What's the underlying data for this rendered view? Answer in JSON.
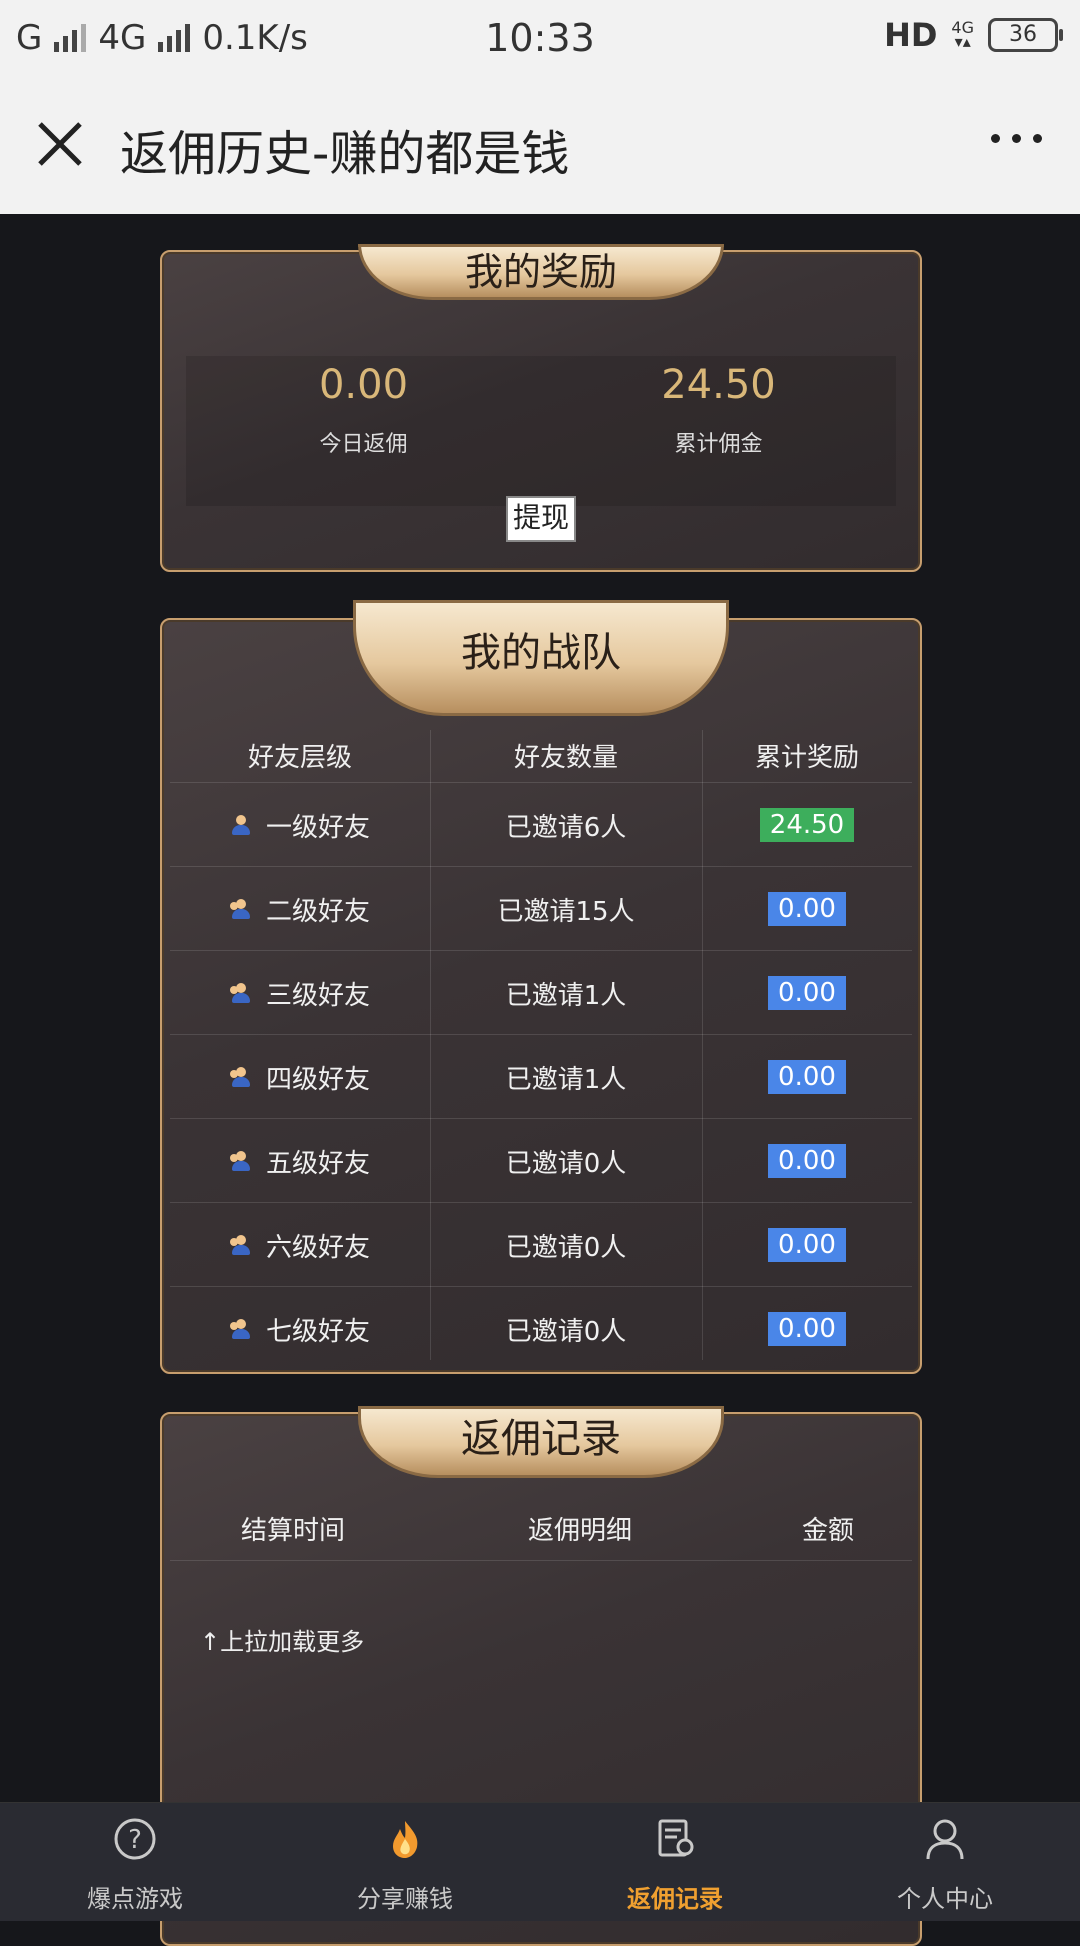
{
  "status_bar": {
    "carrier": "G",
    "network": "4G",
    "speed": "0.1K/s",
    "time": "10:33",
    "hd": "HD",
    "net_badge": "4G",
    "battery": "36"
  },
  "nav": {
    "title": "返佣历史-赚的都是钱"
  },
  "reward": {
    "title": "我的奖励",
    "today_value": "0.00",
    "today_label": "今日返佣",
    "total_value": "24.50",
    "total_label": "累计佣金",
    "withdraw_label": "提现"
  },
  "team": {
    "title": "我的战队",
    "headers": [
      "好友层级",
      "好友数量",
      "累计奖励"
    ],
    "rows": [
      {
        "level": "一级好友",
        "count": "已邀请6人",
        "reward": "24.50",
        "color": "green"
      },
      {
        "level": "二级好友",
        "count": "已邀请15人",
        "reward": "0.00",
        "color": "blue"
      },
      {
        "level": "三级好友",
        "count": "已邀请1人",
        "reward": "0.00",
        "color": "blue"
      },
      {
        "level": "四级好友",
        "count": "已邀请1人",
        "reward": "0.00",
        "color": "blue"
      },
      {
        "level": "五级好友",
        "count": "已邀请0人",
        "reward": "0.00",
        "color": "blue"
      },
      {
        "level": "六级好友",
        "count": "已邀请0人",
        "reward": "0.00",
        "color": "blue"
      },
      {
        "level": "七级好友",
        "count": "已邀请0人",
        "reward": "0.00",
        "color": "blue"
      }
    ]
  },
  "records": {
    "title": "返佣记录",
    "headers": [
      "结算时间",
      "返佣明细",
      "金额"
    ],
    "load_more": "↑上拉加载更多"
  },
  "tabs": [
    {
      "label": "爆点游戏",
      "icon": "question-circle-icon",
      "active": false
    },
    {
      "label": "分享赚钱",
      "icon": "fire-icon",
      "active": false
    },
    {
      "label": "返佣记录",
      "icon": "certificate-icon",
      "active": true
    },
    {
      "label": "个人中心",
      "icon": "user-icon",
      "active": false
    }
  ],
  "colors": {
    "accent_gold": "#d9b779",
    "badge_green": "#3dae5c",
    "badge_blue": "#4a86e8",
    "tab_active": "#f0a030"
  }
}
